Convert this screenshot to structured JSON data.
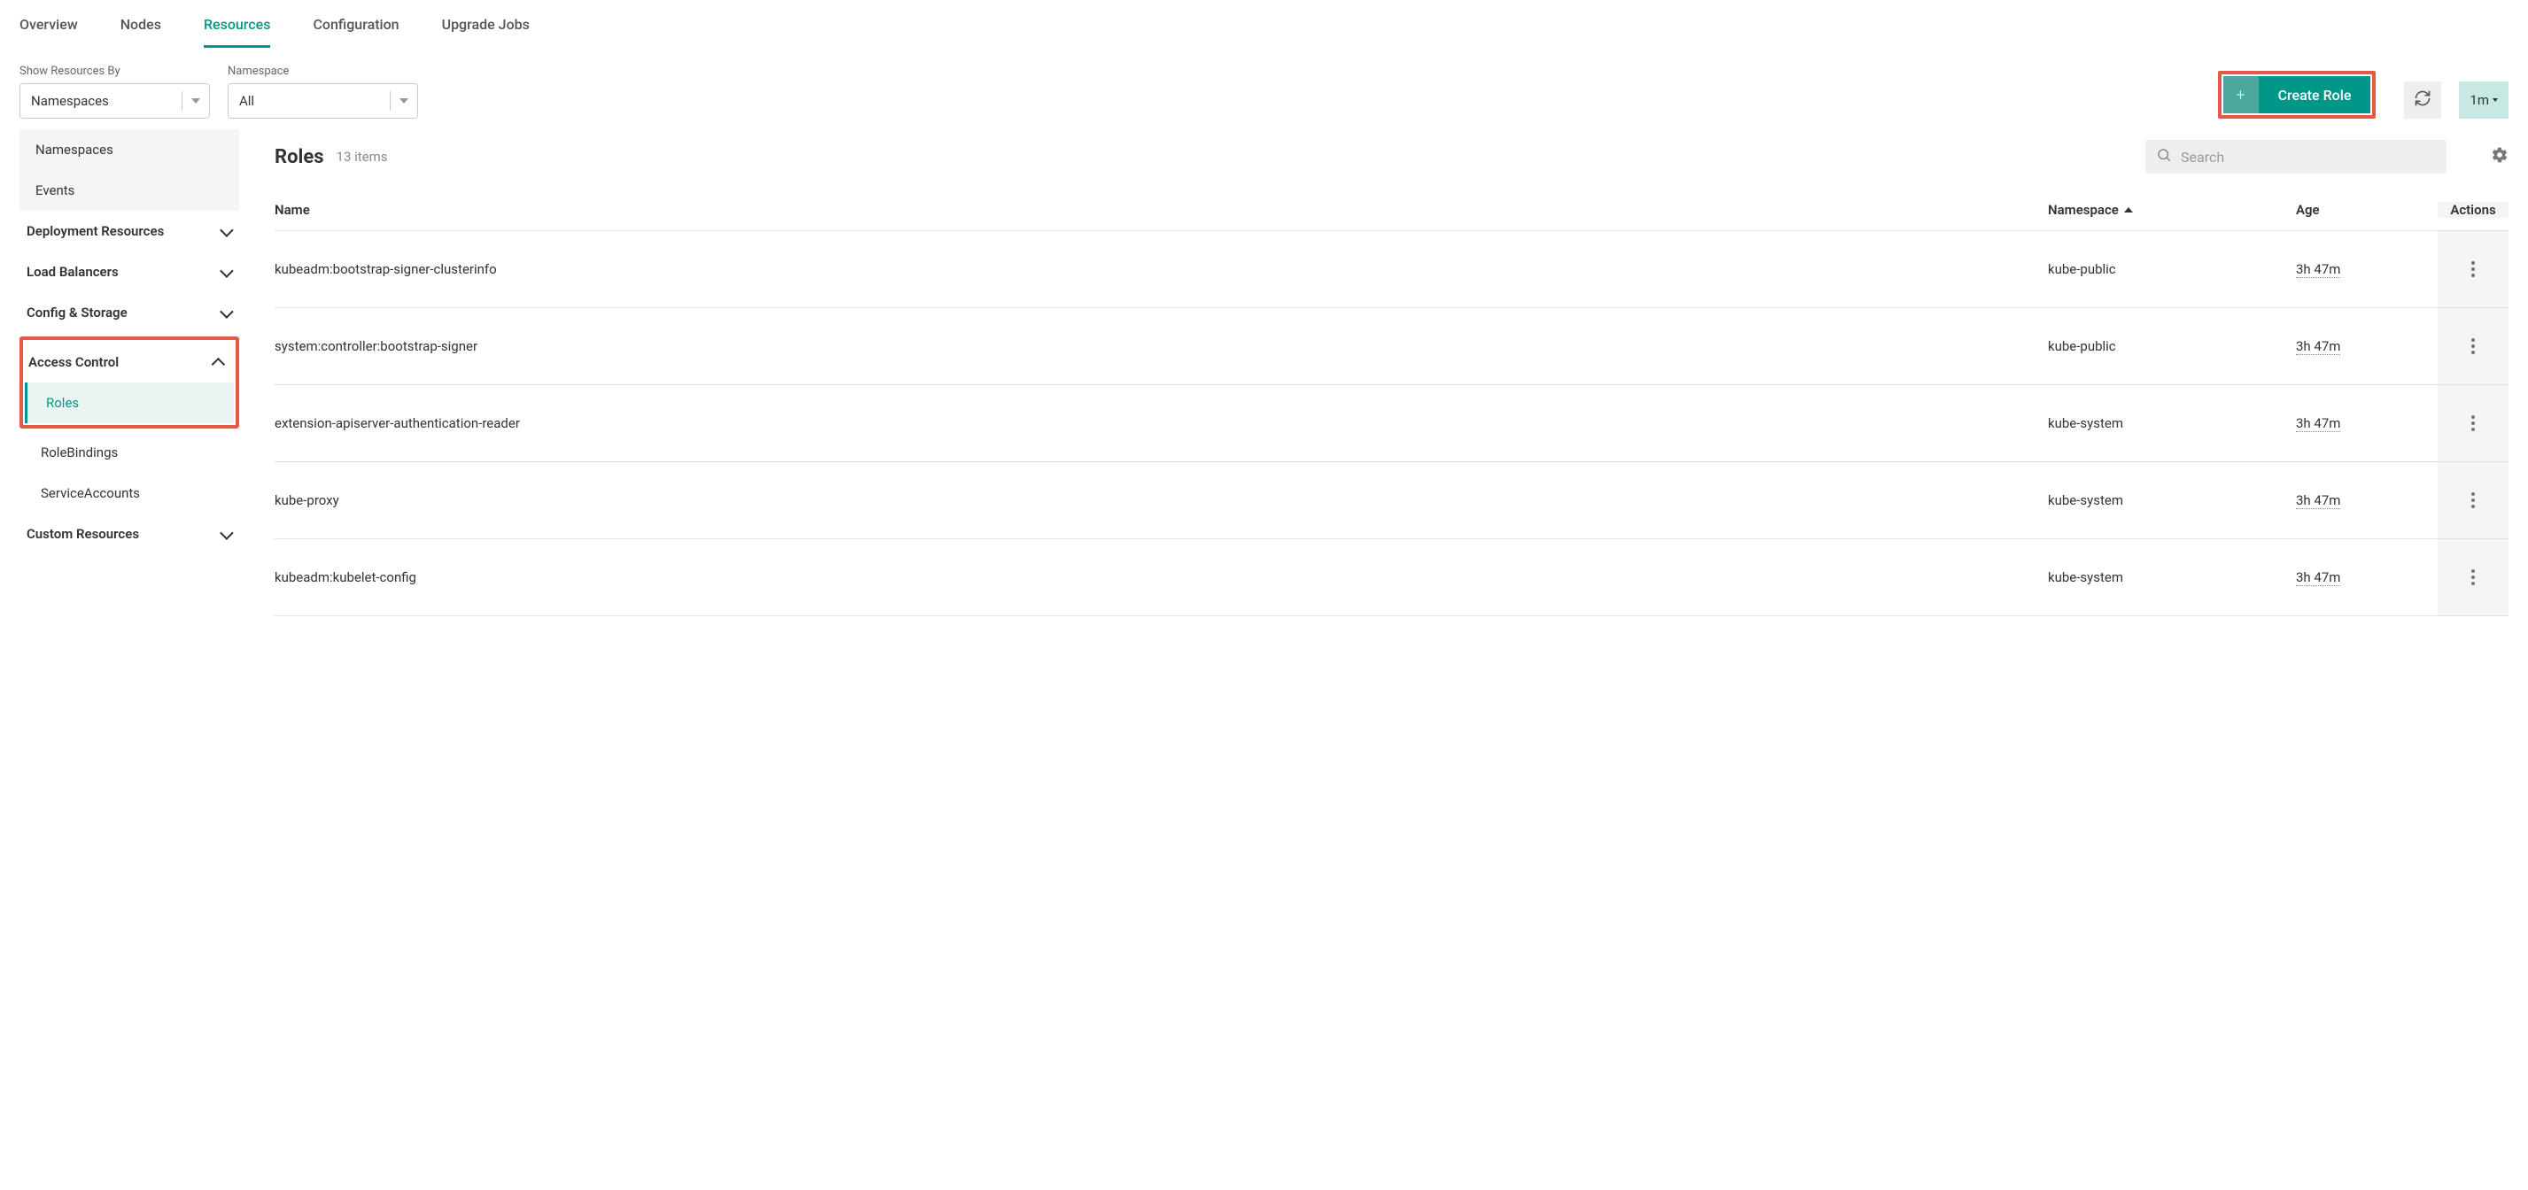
{
  "tabs": {
    "overview": "Overview",
    "nodes": "Nodes",
    "resources": "Resources",
    "configuration": "Configuration",
    "upgrade_jobs": "Upgrade Jobs"
  },
  "filters": {
    "show_by_label": "Show Resources By",
    "show_by_value": "Namespaces",
    "namespace_label": "Namespace",
    "namespace_value": "All"
  },
  "create_button": {
    "label": "Create Role"
  },
  "refresh_interval": "1m",
  "sidebar": {
    "namespaces": "Namespaces",
    "events": "Events",
    "deployment_resources": "Deployment Resources",
    "load_balancers": "Load Balancers",
    "config_storage": "Config & Storage",
    "access_control": "Access Control",
    "roles": "Roles",
    "rolebindings": "RoleBindings",
    "serviceaccounts": "ServiceAccounts",
    "custom_resources": "Custom Resources"
  },
  "content": {
    "title": "Roles",
    "count": "13 items",
    "search_placeholder": "Search"
  },
  "columns": {
    "name": "Name",
    "namespace": "Namespace",
    "age": "Age",
    "actions": "Actions"
  },
  "rows": [
    {
      "name": "kubeadm:bootstrap-signer-clusterinfo",
      "namespace": "kube-public",
      "age": "3h 47m"
    },
    {
      "name": "system:controller:bootstrap-signer",
      "namespace": "kube-public",
      "age": "3h 47m"
    },
    {
      "name": "extension-apiserver-authentication-reader",
      "namespace": "kube-system",
      "age": "3h 47m"
    },
    {
      "name": "kube-proxy",
      "namespace": "kube-system",
      "age": "3h 47m"
    },
    {
      "name": "kubeadm:kubelet-config",
      "namespace": "kube-system",
      "age": "3h 47m"
    }
  ]
}
